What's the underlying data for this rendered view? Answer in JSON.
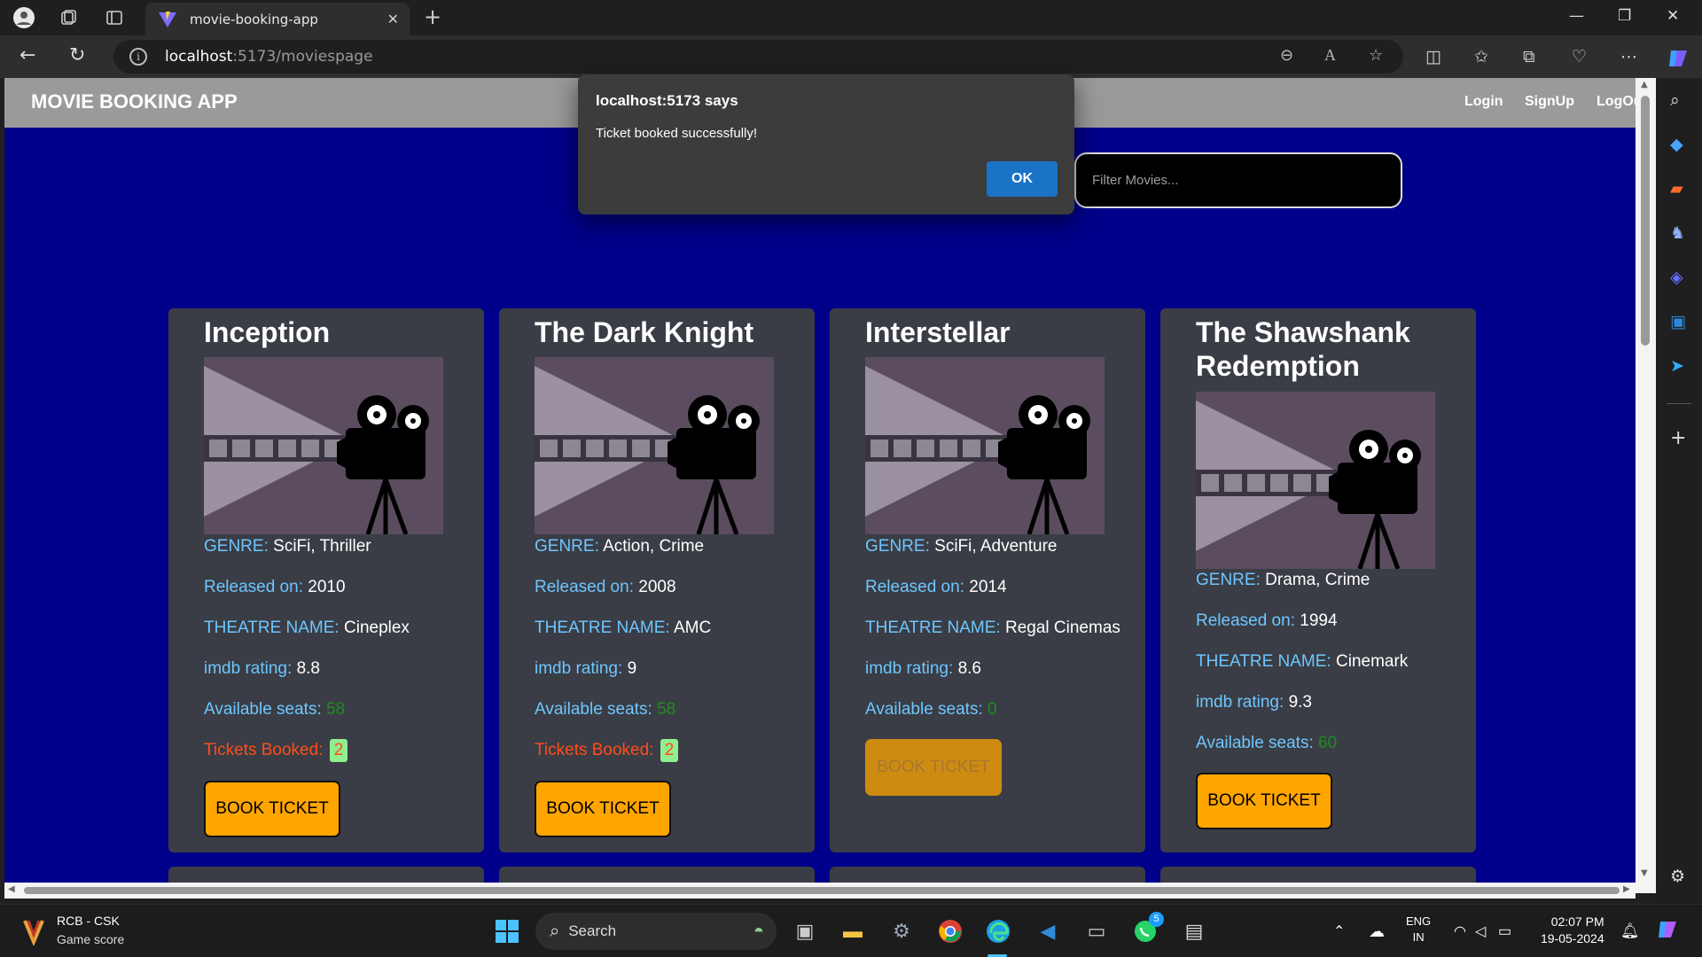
{
  "browser": {
    "tab_title": "movie-booking-app",
    "url_host": "localhost",
    "url_path": ":5173/moviespage"
  },
  "app": {
    "brand": "MOVIE BOOKING APP",
    "nav": {
      "login": "Login",
      "signup": "SignUp",
      "logout": "LogOu"
    },
    "filter_placeholder": "Filter Movies..."
  },
  "dialog": {
    "title": "localhost:5173 says",
    "message": "Ticket booked successfully!",
    "ok": "OK"
  },
  "labels": {
    "genre": "GENRE:",
    "released": "Released on:",
    "theatre": "THEATRE NAME:",
    "imdb": "imdb rating:",
    "seats": "Available seats:",
    "booked": "Tickets Booked:",
    "book_button": "BOOK TICKET"
  },
  "movies": [
    {
      "title": "Inception",
      "genre": "SciFi, Thriller",
      "released": "2010",
      "theatre": "Cineplex",
      "imdb": "8.8",
      "seats": "58",
      "booked": "2"
    },
    {
      "title": "The Dark Knight",
      "genre": "Action, Crime",
      "released": "2008",
      "theatre": "AMC",
      "imdb": "9",
      "seats": "58",
      "booked": "2"
    },
    {
      "title": "Interstellar",
      "genre": "SciFi, Adventure",
      "released": "2014",
      "theatre": "Regal Cinemas",
      "imdb": "8.6",
      "seats": "0"
    },
    {
      "title": "The Shawshank Redemption",
      "genre": "Drama, Crime",
      "released": "1994",
      "theatre": "Cinemark",
      "imdb": "9.3",
      "seats": "60"
    }
  ],
  "taskbar": {
    "widget_title": "RCB - CSK",
    "widget_sub": "Game score",
    "search": "Search",
    "lang1": "ENG",
    "lang2": "IN",
    "time": "02:07 PM",
    "date": "19-05-2024",
    "whatsapp_badge": "5"
  }
}
